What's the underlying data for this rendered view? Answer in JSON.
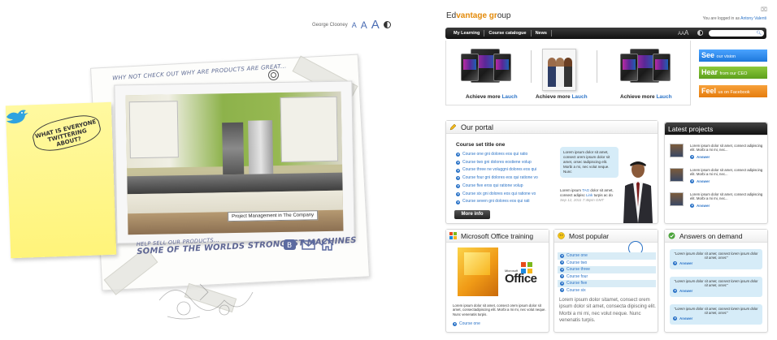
{
  "left": {
    "accessibility": {
      "user": "George Clooney",
      "a1": "A",
      "a2": "A",
      "a3": "A"
    },
    "sheet_title": "WHY NOT CHECK OUT WHY ARE PRODUCTS ARE GREAT...",
    "sticky_note": "WHAT IS EVERYONE TWITTERING ABOUT?",
    "photo_caption": "Project Management in The Company",
    "help_line1": "HELP SELL OUR PRODUCTS...",
    "help_line2": "SOME OF THE WORLDS STRONGEST MACHINES"
  },
  "portal": {
    "logo": {
      "pre": "Ed",
      "mid": "vantage gr",
      "o": "o",
      "post": "up"
    },
    "logged_in_prefix": "You are logged in as",
    "logged_in_user": "Antony Valenti",
    "nav": [
      "My Learning",
      "Course catalogue",
      "News"
    ],
    "nav_aaa": {
      "a1": "A",
      "a2": "A",
      "a3": "A"
    },
    "promos": [
      {
        "text": "Achieve more",
        "link": "Lauch"
      },
      {
        "text": "Achieve more",
        "link": "Lauch"
      },
      {
        "text": "Achieve more",
        "link": "Lauch"
      }
    ],
    "side_buttons": [
      {
        "big": "See",
        "small": "our vision",
        "color": "#1d78dc"
      },
      {
        "big": "Hear",
        "small": "from our CEO",
        "color": "#5da11d"
      },
      {
        "big": "Feel",
        "small": "us on Facebook",
        "color": "#e57c0e"
      }
    ],
    "our_portal": {
      "title": "Our portal",
      "course_title": "Course set title one",
      "courses": [
        "Course one gni dolores eos qui ratio",
        "Course two gni dolores eostiene volup",
        "Course three ne voluggni dolores eos qui",
        "Course four gni dolores eos qui ratione vo",
        "Course five eros qui ratione volup",
        "Course six gni dolores eos qui ratione vo",
        "Course seven gni dolores eos qui rati"
      ],
      "more": "More info",
      "bubble": "Lorem ipsum dolor sit amet, consect orem ipsum dolor sit amet, orsec tadipiscing elit. Morbi a mi, nec volut neque. Nunc",
      "quote_pre": "Lorem ipsum",
      "quote_tag": "TAG",
      "quote_mid": "dolor sit amet, consect adipisc",
      "quote_link": "Link",
      "quote_post": "turpis ac do",
      "quote_date": "Sep 12, 2011 7:46pm GMT"
    },
    "latest": {
      "title": "Latest projects",
      "items": [
        {
          "text": "Lorem ipsum dolor sit amet, consect adipiscing elit. Morbi a mi mi, nec...",
          "answer": "Answer"
        },
        {
          "text": "Lorem ipsum dolor sit amet, consect adipiscing elit. Morbi a mi mi, nec...",
          "answer": "Answer"
        },
        {
          "text": "Lorem ipsum dolor sit amet, consect adipiscing elit. Morbi a mi mi, nec...",
          "answer": "Answer"
        }
      ]
    },
    "office": {
      "title": "Microsoft Office training",
      "ms": "Microsoft",
      "word": "Office",
      "text": "Lorem ipsum dolor sit amet, consect orem ipsum dolor sit amet, consectadipiscing elit. Morbi a mi mi, nec volut neque. Nunc venenatis turpis.",
      "link": "Course one"
    },
    "popular": {
      "title": "Most popular",
      "items": [
        "Course one",
        "Course two",
        "Course three",
        "Course four",
        "Course five",
        "Course six"
      ],
      "text": "Lorem ipsum dolor sitamet, consect orem ipsum dolor sit amet, consecta dipiscing elit. Morbi a mi mi, nec volut neque. Nunc venenatis turpis."
    },
    "answers": {
      "title": "Answers on demand",
      "items": [
        {
          "q": "\"Lorem ipsum dolor sit amet, consect lorem ipsum dolor sit amet, orsec\"",
          "a": "Answer"
        },
        {
          "q": "\"Lorem ipsum dolor sit amet, consect lorem ipsum dolor sit amet, orsec\"",
          "a": "Answer"
        },
        {
          "q": "\"Lorem ipsum dolor sit amet, consect lorem ipsum dolor sit amet, orsec\"",
          "a": "Answer"
        }
      ]
    }
  }
}
